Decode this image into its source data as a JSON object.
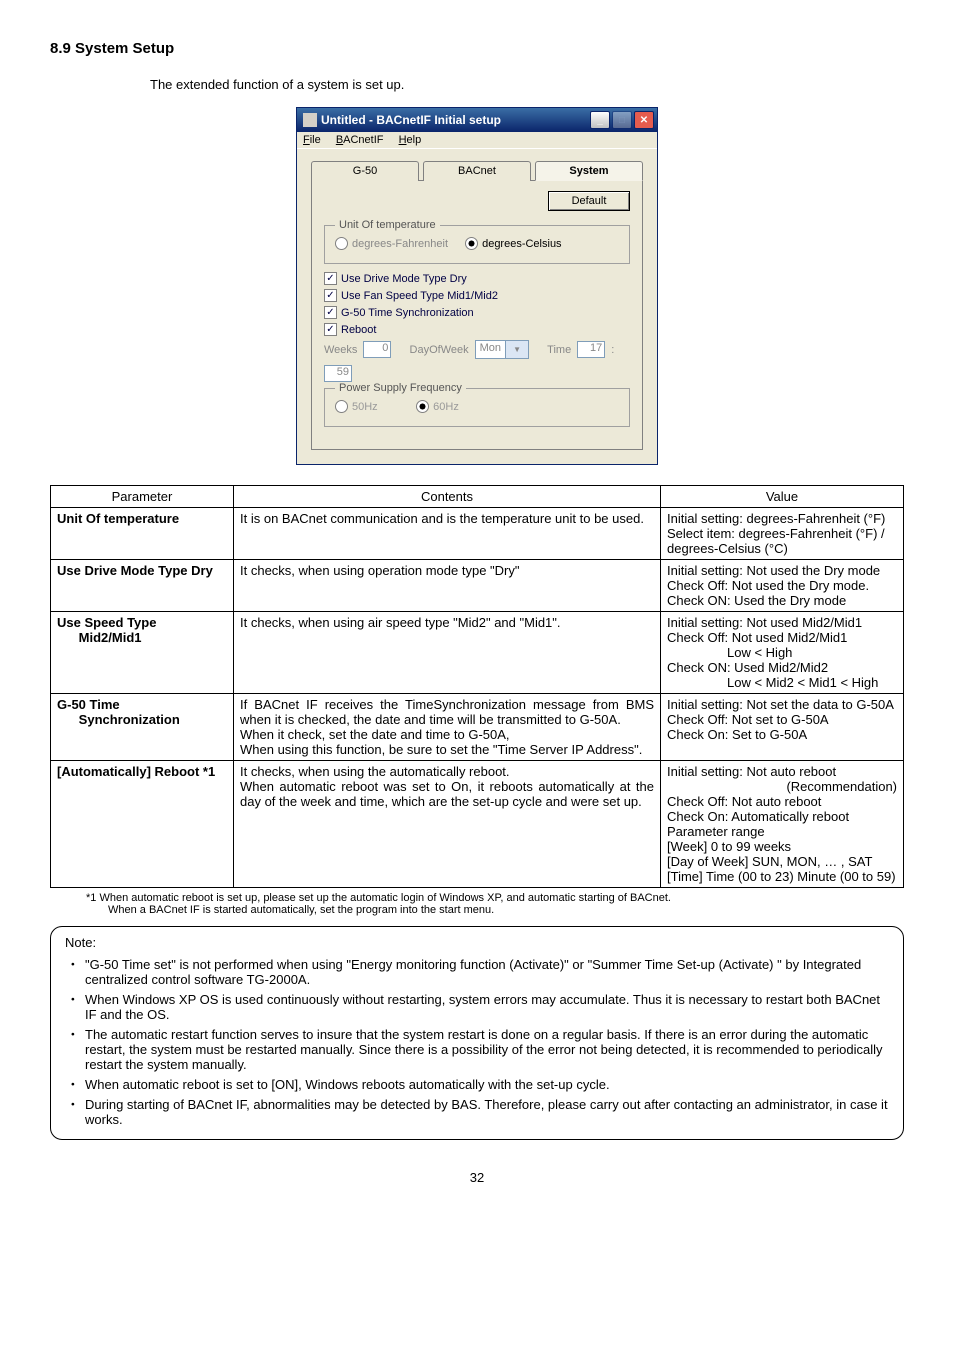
{
  "page": {
    "section_heading": "8.9 System Setup",
    "intro": "The extended function of a system is set up.",
    "number": "32"
  },
  "dialog": {
    "title": "Untitled - BACnetIF Initial setup",
    "menus": {
      "file": "File",
      "bacnet": "BACnetIF",
      "help": "Help"
    },
    "tabs": {
      "g50": "G-50",
      "bacnet": "BACnet",
      "system": "System"
    },
    "default_btn": "Default",
    "group_unit": "Unit Of temperature",
    "rad_f": "degrees-Fahrenheit",
    "rad_c": "degrees-Celsius",
    "ck_dry": "Use Drive Mode Type Dry",
    "ck_fan": "Use Fan Speed Type Mid1/Mid2",
    "ck_sync": "G-50 Time Synchronization",
    "ck_reboot": "Reboot",
    "weeks_lbl": "Weeks",
    "weeks_val": "0",
    "dow_lbl": "DayOfWeek",
    "dow_val": "Mon",
    "time_lbl": "Time",
    "time_h": "17",
    "time_m": "59",
    "group_freq": "Power Supply Frequency",
    "rad_50": "50Hz",
    "rad_60": "60Hz"
  },
  "table": {
    "headers": [
      "Parameter",
      "Contents",
      "Value"
    ],
    "rows": [
      {
        "p": "Unit Of temperature",
        "c": "It is on BACnet communication and is the temperature unit to be used.",
        "v": "Initial setting: degrees-Fahrenheit (°F)\nSelect item: degrees-Fahrenheit (°F) / degrees-Celsius (°C)"
      },
      {
        "p": "Use Drive Mode Type Dry",
        "c": "It checks, when using operation mode type \"Dry\"",
        "v": "Initial setting: Not used the Dry mode\nCheck Off: Not used the Dry mode.\nCheck ON: Used the Dry mode"
      },
      {
        "p": "Use Speed Type",
        "p2": "Mid2/Mid1",
        "c": "It checks, when using air speed type \"Mid2\" and \"Mid1\".",
        "v": "Initial setting: Not used Mid2/Mid1\nCheck Off: Not used Mid2/Mid1",
        "v2": "Low < High",
        "v3": "Check ON: Used Mid2/Mid2",
        "v4": "Low < Mid2 < Mid1 < High"
      },
      {
        "p": "G-50 Time",
        "p2": "Synchronization",
        "c": "If BACnet IF receives the TimeSynchronization message from BMS when it is checked, the date and time will be transmitted to G-50A.\nWhen it check, set the date and time to G-50A,\nWhen using this function, be sure to set the \"Time Server IP Address\".",
        "v": "Initial setting: Not set the data to G-50A\nCheck Off: Not set to G-50A\nCheck On: Set to G-50A"
      },
      {
        "p": "[Automatically] Reboot *1",
        "c": "It checks, when using the automatically reboot.\nWhen automatic reboot was set to On, it reboots automatically at the day of the week and time, which are the set-up cycle and were set up.",
        "v": "Initial setting: Not auto reboot",
        "v2": "(Recommendation)",
        "v3": "Check Off: Not auto reboot\nCheck On: Automatically reboot\nParameter range\n    [Week] 0 to 99 weeks\n    [Day of Week] SUN, MON, … , SAT\n    [Time] Time (00 to 23) Minute (00 to 59)"
      }
    ]
  },
  "footnotes": {
    "f1": "*1 When automatic reboot is set up, please set up the automatic login of Windows XP, and automatic starting of BACnet.",
    "f2": "When a BACnet IF is started automatically, set the program into the start menu."
  },
  "note": {
    "title": "Note:",
    "items": [
      "\"G-50 Time set\" is not performed when using \"Energy monitoring function (Activate)\" or \"Summer Time Set-up (Activate) \" by Integrated centralized control software TG-2000A.",
      "When Windows XP OS is used continuously without restarting, system errors may accumulate. Thus it is necessary to restart both BACnet IF and the OS.",
      "The automatic restart function serves to insure that the system restart is done on a regular basis. If there is an error during the automatic restart, the system must be restarted manually. Since there is a possibility of the error not being detected, it is recommended to periodically restart the system manually.",
      "When automatic reboot is set to [ON], Windows reboots automatically with the set-up cycle.",
      "During starting of BACnet IF, abnormalities may be detected by BAS. Therefore, please carry out after contacting an administrator, in case it works."
    ]
  }
}
